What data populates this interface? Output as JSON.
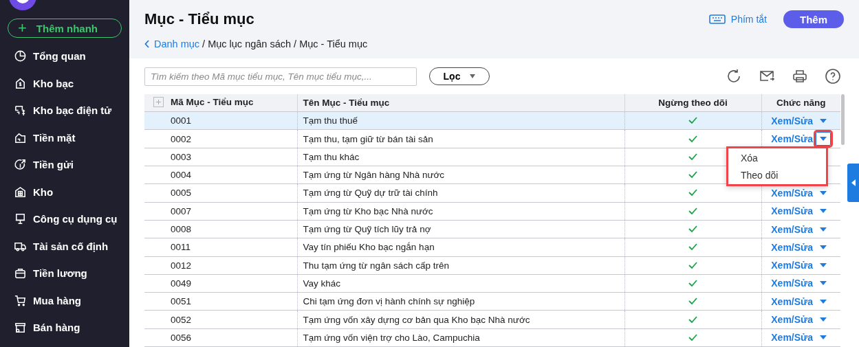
{
  "sidebar": {
    "quick_add": {
      "icon": "+",
      "label": "Thêm nhanh"
    },
    "items": [
      {
        "label": "Tổng quan"
      },
      {
        "label": "Kho bạc"
      },
      {
        "label": "Kho bạc điện tử"
      },
      {
        "label": "Tiền mặt"
      },
      {
        "label": "Tiền gửi"
      },
      {
        "label": "Kho"
      },
      {
        "label": "Công cụ dụng cụ"
      },
      {
        "label": "Tài sản cố định"
      },
      {
        "label": "Tiền lương"
      },
      {
        "label": "Mua hàng"
      },
      {
        "label": "Bán hàng"
      }
    ]
  },
  "header": {
    "title": "Mục - Tiểu mục",
    "shortcuts": "Phím tắt",
    "add_button": "Thêm",
    "breadcrumb": [
      {
        "label": "Danh mục",
        "kind": "link"
      },
      {
        "label": "/ Mục lục ngân sách / Mục - Tiểu mục",
        "kind": "text"
      }
    ]
  },
  "toolbar": {
    "search": {
      "placeholder": "Tìm kiếm theo Mã mục tiểu mục, Tên mục tiểu mục,..."
    },
    "filter": "Lọc"
  },
  "table": {
    "columns": [
      "Mã Mục - Tiểu mục",
      "Tên Mục - Tiểu mục",
      "Ngừng theo dõi",
      "Chức năng"
    ],
    "rows": [
      {
        "code": "0001",
        "name": "Tạm thu thuế",
        "stopped": true,
        "action": "Xem/Sửa",
        "selected": true,
        "menu_open": false
      },
      {
        "code": "0002",
        "name": "Tạm thu, tạm giữ từ bán tài sản",
        "stopped": true,
        "action": "Xem/Sửa",
        "selected": false,
        "menu_open": true
      },
      {
        "code": "0003",
        "name": "Tạm thu khác",
        "stopped": true,
        "selected": false,
        "menu_open": false
      },
      {
        "code": "0004",
        "name": "Tạm ứng từ Ngân hàng Nhà nước",
        "stopped": true,
        "selected": false,
        "menu_open": false
      },
      {
        "code": "0005",
        "name": "Tạm ứng từ Quỹ dự trữ tài chính",
        "stopped": true,
        "action": "Xem/Sửa",
        "selected": false,
        "menu_open": false
      },
      {
        "code": "0007",
        "name": "Tạm ứng từ Kho bạc Nhà nước",
        "stopped": true,
        "action": "Xem/Sửa",
        "selected": false,
        "menu_open": false
      },
      {
        "code": "0008",
        "name": "Tạm ứng từ Quỹ tích lũy trả nợ",
        "stopped": true,
        "action": "Xem/Sửa",
        "selected": false,
        "menu_open": false
      },
      {
        "code": "0011",
        "name": "Vay tín phiếu Kho bạc ngắn hạn",
        "stopped": true,
        "action": "Xem/Sửa",
        "selected": false,
        "menu_open": false
      },
      {
        "code": "0012",
        "name": "Thu tạm ứng từ ngân sách cấp trên",
        "stopped": true,
        "action": "Xem/Sửa",
        "selected": false,
        "menu_open": false
      },
      {
        "code": "0049",
        "name": "Vay khác",
        "stopped": true,
        "action": "Xem/Sửa",
        "selected": false,
        "menu_open": false
      },
      {
        "code": "0051",
        "name": "Chi tạm ứng đơn vị hành chính sự nghiệp",
        "stopped": true,
        "action": "Xem/Sửa",
        "selected": false,
        "menu_open": false
      },
      {
        "code": "0052",
        "name": "Tạm ứng vốn xây dựng cơ bản qua Kho bạc Nhà nước",
        "stopped": true,
        "action": "Xem/Sửa",
        "selected": false,
        "menu_open": false
      },
      {
        "code": "0056",
        "name": "Tạm ứng vốn viện trợ cho Lào, Campuchia",
        "stopped": true,
        "action": "Xem/Sửa",
        "selected": false,
        "menu_open": false
      }
    ],
    "row_menu": [
      "Xóa",
      "Theo dõi"
    ]
  }
}
